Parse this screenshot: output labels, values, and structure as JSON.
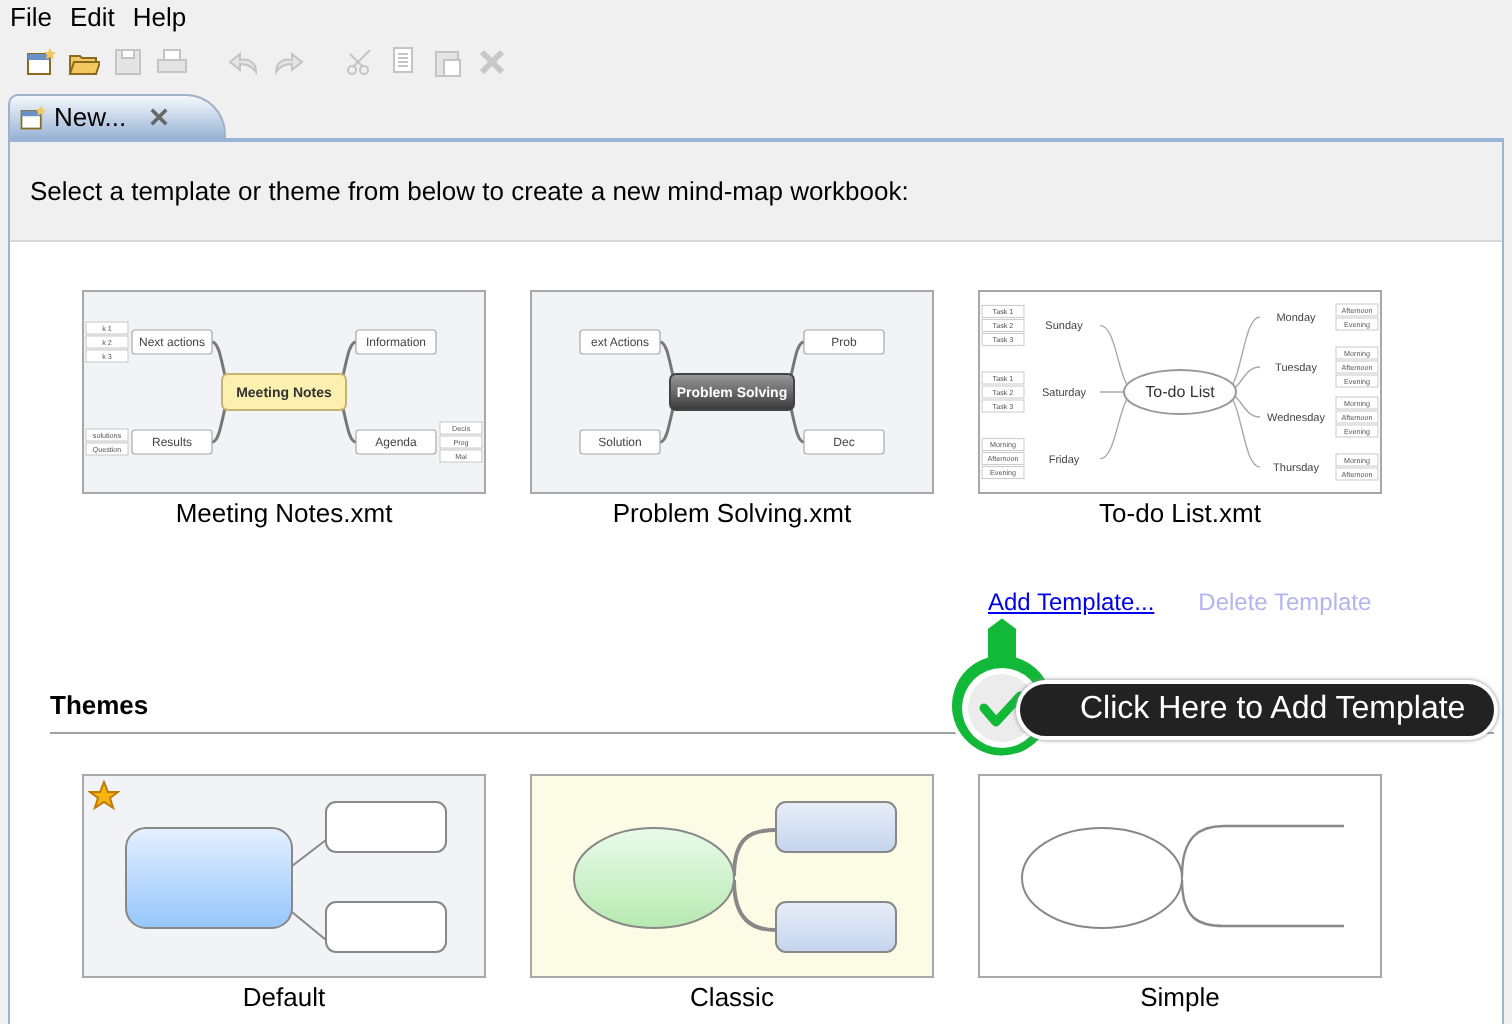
{
  "menu": [
    {
      "label": "File"
    },
    {
      "label": "Edit"
    },
    {
      "label": "Help"
    }
  ],
  "toolbar": [
    {
      "kind": "new",
      "disabled": false
    },
    {
      "kind": "open",
      "disabled": false
    },
    {
      "kind": "save",
      "disabled": true
    },
    {
      "kind": "print",
      "disabled": true
    },
    {
      "kind": "undo",
      "disabled": true
    },
    {
      "kind": "redo",
      "disabled": true
    },
    {
      "kind": "cut",
      "disabled": true
    },
    {
      "kind": "copy",
      "disabled": true
    },
    {
      "kind": "paste",
      "disabled": true
    },
    {
      "kind": "delete",
      "disabled": true
    }
  ],
  "tabs": [
    {
      "label": "New...",
      "selected": true
    }
  ],
  "instruction": "Select a template or theme from below to create a new mind-map workbook:",
  "templates": [
    {
      "name": "Meeting Notes.xmt",
      "kind": "meeting",
      "center": "Meeting Notes",
      "left_topics": [
        {
          "label": "Next actions",
          "children": [
            "k 1",
            "k 2",
            "k 3"
          ]
        },
        {
          "label": "Results",
          "children": [
            "solutions",
            "Question"
          ]
        }
      ],
      "right_topics": [
        {
          "label": "Information"
        },
        {
          "label": "Agenda",
          "children": [
            "Decis",
            "Prog",
            "Mai"
          ]
        }
      ]
    },
    {
      "name": "Problem Solving.xmt",
      "kind": "problem",
      "center": "Problem Solving",
      "left_topics": [
        {
          "label": "ext Actions"
        },
        {
          "label": "Solution"
        }
      ],
      "right_topics": [
        {
          "label": "Prob"
        },
        {
          "label": "Dec"
        }
      ]
    },
    {
      "name": "To-do List.xmt",
      "kind": "todo",
      "center": "To-do List",
      "left_topics": [
        {
          "label": "Sunday",
          "children": [
            "Task 1",
            "Task 2",
            "Task 3"
          ]
        },
        {
          "label": "Saturday",
          "children": [
            "Task 1",
            "Task 2",
            "Task 3"
          ]
        },
        {
          "label": "Friday",
          "children": [
            "Morning",
            "Afternoon",
            "Evening"
          ]
        }
      ],
      "right_topics": [
        {
          "label": "Monday",
          "children": [
            "Afternoon",
            "Evening"
          ]
        },
        {
          "label": "Tuesday",
          "children": [
            "Morning",
            "Afternoon",
            "Evening"
          ]
        },
        {
          "label": "Wednesday",
          "children": [
            "Morning",
            "Afternoon",
            "Evening"
          ]
        },
        {
          "label": "Thursday",
          "children": [
            "Morning",
            "Afternoon"
          ]
        }
      ]
    }
  ],
  "template_actions": [
    {
      "label": "Add Template...",
      "disabled": false
    },
    {
      "label": "Delete Template",
      "disabled": true
    }
  ],
  "themes_heading": "Themes",
  "themes": [
    {
      "name": "Default",
      "kind": "default",
      "starred": true
    },
    {
      "name": "Classic",
      "kind": "classic",
      "starred": false
    },
    {
      "name": "Simple",
      "kind": "simple",
      "starred": false
    }
  ],
  "callout": {
    "text": "Click Here to Add Template"
  }
}
